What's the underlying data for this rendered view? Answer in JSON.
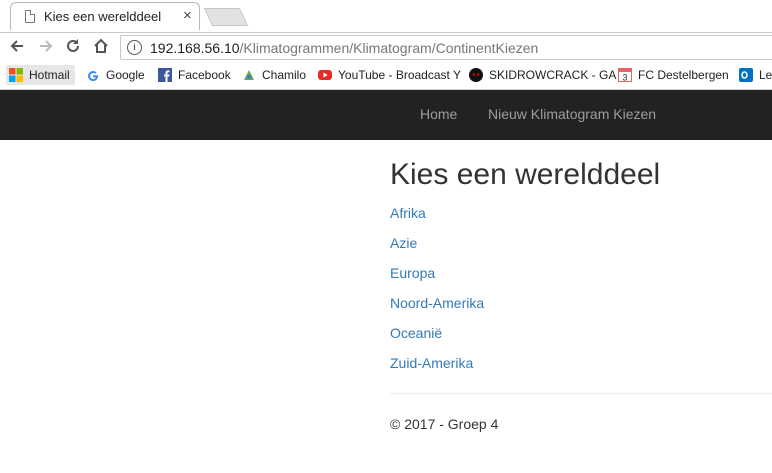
{
  "browser": {
    "tab": {
      "title": "Kies een werelddeel",
      "close": "×"
    },
    "address": {
      "host": "192.168.56.10",
      "path": "/Klimatogrammen/Klimatogram/ContinentKiezen"
    },
    "bookmarks": [
      {
        "label": "Hotmail",
        "icon": "windows-logo-icon"
      },
      {
        "label": "Google",
        "icon": "google-g-icon"
      },
      {
        "label": "Facebook",
        "icon": "facebook-icon"
      },
      {
        "label": "Chamilo",
        "icon": "chamilo-icon"
      },
      {
        "label": "YouTube - Broadcast Y",
        "icon": "youtube-icon"
      },
      {
        "label": "SKIDROWCRACK - GA",
        "icon": "skull-icon"
      },
      {
        "label": "FC Destelbergen",
        "icon": "calendar-3-icon"
      },
      {
        "label": "Le",
        "icon": "outlook-icon"
      }
    ]
  },
  "navbar": {
    "links": [
      "Home",
      "Nieuw Klimatogram Kiezen"
    ]
  },
  "main": {
    "title": "Kies een werelddeel",
    "continents": [
      "Afrika",
      "Azie",
      "Europa",
      "Noord-Amerika",
      "Oceanië",
      "Zuid-Amerika"
    ]
  },
  "footer": {
    "text": "© 2017 - Groep 4"
  }
}
